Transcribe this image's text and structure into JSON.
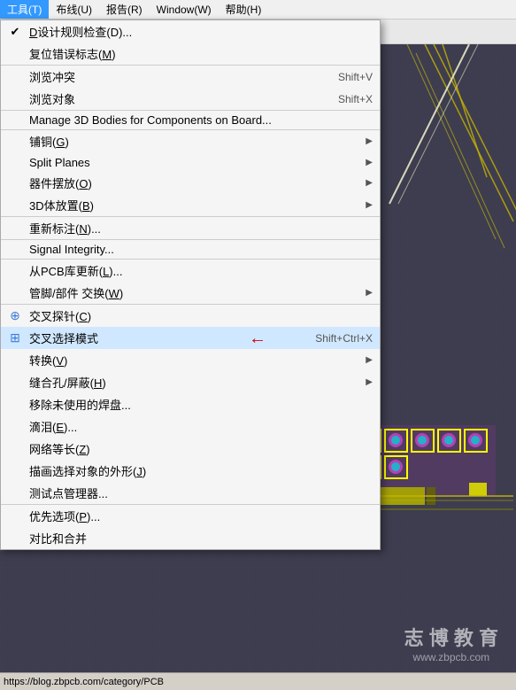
{
  "menubar": {
    "items": [
      {
        "label": "工具(T)",
        "id": "tools",
        "active": true
      },
      {
        "label": "布线(U)",
        "id": "route"
      },
      {
        "label": "报告(R)",
        "id": "report"
      },
      {
        "label": "Window(W)",
        "id": "window"
      },
      {
        "label": "帮助(H)",
        "id": "help"
      }
    ]
  },
  "dropdown": {
    "items": [
      {
        "label": "设计规则检查(D)...",
        "shortcut": "",
        "hasArrow": false,
        "hasIcon": true,
        "iconType": "drc",
        "separatorAfter": false
      },
      {
        "label": "复位错误标志(M)",
        "shortcut": "",
        "hasArrow": false,
        "hasIcon": false,
        "separatorAfter": true
      },
      {
        "label": "浏览冲突",
        "shortcut": "Shift+V",
        "hasArrow": false,
        "hasIcon": false,
        "separatorAfter": false
      },
      {
        "label": "浏览对象",
        "shortcut": "Shift+X",
        "hasArrow": false,
        "hasIcon": false,
        "separatorAfter": true
      },
      {
        "label": "Manage 3D Bodies for Components on Board...",
        "shortcut": "",
        "hasArrow": false,
        "hasIcon": false,
        "separatorAfter": true
      },
      {
        "label": "铺铜(G)",
        "shortcut": "",
        "hasArrow": true,
        "hasIcon": false,
        "separatorAfter": false
      },
      {
        "label": "Split Planes",
        "shortcut": "",
        "hasArrow": true,
        "hasIcon": false,
        "separatorAfter": false
      },
      {
        "label": "器件摆放(O)",
        "shortcut": "",
        "hasArrow": true,
        "hasIcon": false,
        "separatorAfter": false
      },
      {
        "label": "3D体放置(B)",
        "shortcut": "",
        "hasArrow": true,
        "hasIcon": false,
        "separatorAfter": true
      },
      {
        "label": "重新标注(N)...",
        "shortcut": "",
        "hasArrow": false,
        "hasIcon": false,
        "separatorAfter": true
      },
      {
        "label": "Signal Integrity...",
        "shortcut": "",
        "hasArrow": false,
        "hasIcon": false,
        "separatorAfter": true
      },
      {
        "label": "从PCB库更新(L)...",
        "shortcut": "",
        "hasArrow": false,
        "hasIcon": false,
        "separatorAfter": false
      },
      {
        "label": "管脚/部件 交换(W)",
        "shortcut": "",
        "hasArrow": true,
        "hasIcon": false,
        "separatorAfter": true
      },
      {
        "label": "交叉探针(C)",
        "shortcut": "",
        "hasArrow": false,
        "hasIcon": true,
        "iconType": "probe",
        "separatorAfter": false
      },
      {
        "label": "交叉选择模式",
        "shortcut": "Shift+Ctrl+X",
        "hasArrow": false,
        "hasIcon": true,
        "iconType": "select",
        "separatorAfter": false,
        "redArrow": true,
        "highlighted": true
      },
      {
        "label": "转换(V)",
        "shortcut": "",
        "hasArrow": true,
        "hasIcon": false,
        "separatorAfter": false
      },
      {
        "label": "缝合孔/屏蔽(H)",
        "shortcut": "",
        "hasArrow": true,
        "hasIcon": false,
        "separatorAfter": false
      },
      {
        "label": "移除未使用的焊盘...",
        "shortcut": "",
        "hasArrow": false,
        "hasIcon": false,
        "separatorAfter": false
      },
      {
        "label": "滴泪(E)...",
        "shortcut": "",
        "hasArrow": false,
        "hasIcon": false,
        "separatorAfter": false
      },
      {
        "label": "网络等长(Z)",
        "shortcut": "",
        "hasArrow": false,
        "hasIcon": false,
        "separatorAfter": false
      },
      {
        "label": "描画选择对象的外形(J)",
        "shortcut": "",
        "hasArrow": false,
        "hasIcon": false,
        "separatorAfter": false
      },
      {
        "label": "测试点管理器...",
        "shortcut": "",
        "hasArrow": false,
        "hasIcon": false,
        "separatorAfter": true
      },
      {
        "label": "优先选项(P)...",
        "shortcut": "",
        "hasArrow": false,
        "hasIcon": false,
        "separatorAfter": false
      },
      {
        "label": "对比和合并",
        "shortcut": "",
        "hasArrow": false,
        "hasIcon": false,
        "separatorAfter": false
      }
    ]
  },
  "watermark": {
    "title": "志 博 教 育",
    "url": "www.zbpcb.com"
  },
  "urlbar": {
    "text": "https://blog.zbpcb.com/category/PCB"
  }
}
